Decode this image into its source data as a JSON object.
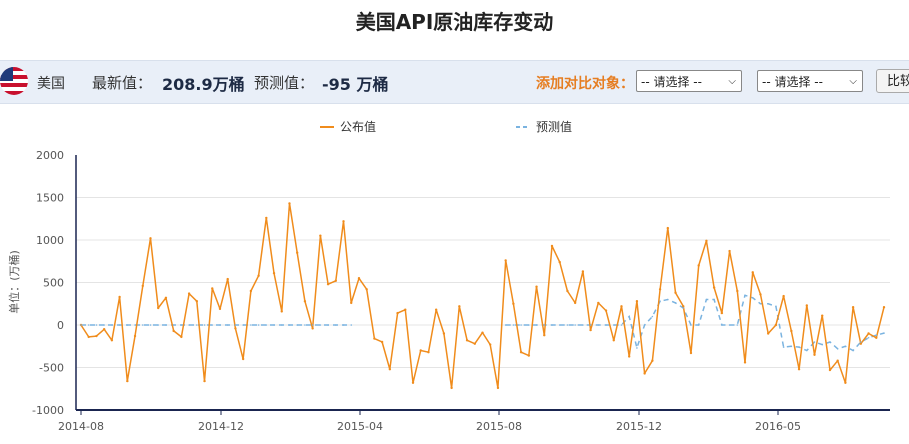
{
  "page": {
    "title": "美国API原油库存变动"
  },
  "info": {
    "country": "美国",
    "latest_label": "最新值：",
    "latest_value": "208.9万桶",
    "forecast_label": "预测值：",
    "forecast_value": "-95 万桶",
    "compare_label": "添加对比对象：",
    "select1": "-- 请选择 --",
    "select2": "-- 请选择 --",
    "compare_button": "比较"
  },
  "icons": {
    "flag": "us-flag-icon"
  },
  "colors": {
    "actual": "#f08c1c",
    "forecast": "#7ab3e0",
    "axis": "#1a2550"
  },
  "chart_data": {
    "type": "line",
    "ylabel": "单位：(万桶)",
    "ylim": [
      -1000,
      2000
    ],
    "yticks": [
      "2000",
      "1500",
      "1000",
      "500",
      "0",
      "-500",
      "-1000"
    ],
    "xticks": [
      "2014-08",
      "2014-12",
      "2015-04",
      "2015-08",
      "2015-12",
      "2016-05"
    ],
    "legend": [
      "公布值",
      "预测值"
    ],
    "legend_position": "top-center",
    "grid": true,
    "series": [
      {
        "name": "公布值",
        "values": [
          0,
          -140,
          -130,
          -50,
          -180,
          330,
          -660,
          -130,
          460,
          1020,
          200,
          320,
          -70,
          -140,
          370,
          280,
          -660,
          430,
          190,
          540,
          -40,
          -400,
          400,
          580,
          1260,
          610,
          160,
          1430,
          850,
          280,
          -40,
          1050,
          480,
          520,
          1220,
          260,
          550,
          420,
          -160,
          -200,
          -520,
          140,
          180,
          -680,
          -300,
          -320,
          180,
          -100,
          -740,
          220,
          -180,
          -220,
          -90,
          -230,
          -740,
          760,
          250,
          -320,
          -360,
          450,
          -120,
          930,
          740,
          400,
          260,
          630,
          -60,
          260,
          170,
          -180,
          220,
          -370,
          280,
          -570,
          -420,
          420,
          1140,
          380,
          220,
          -330,
          700,
          990,
          440,
          140,
          870,
          400,
          -440,
          620,
          360,
          -100,
          0,
          340,
          -70,
          -520,
          230,
          -350,
          110,
          -530,
          -420,
          -680,
          210,
          -220,
          -100,
          -150,
          209
        ]
      },
      {
        "name": "预测值",
        "values": [
          0,
          0,
          0,
          0,
          0,
          0,
          0,
          0,
          0,
          0,
          0,
          0,
          0,
          0,
          0,
          0,
          0,
          0,
          0,
          0,
          0,
          0,
          0,
          0,
          0,
          0,
          0,
          0,
          0,
          0,
          0,
          0,
          0,
          0,
          0,
          0,
          null,
          null,
          null,
          null,
          null,
          null,
          null,
          null,
          null,
          null,
          null,
          null,
          null,
          null,
          null,
          null,
          null,
          null,
          null,
          0,
          0,
          0,
          0,
          0,
          0,
          0,
          0,
          0,
          0,
          0,
          0,
          0,
          0,
          0,
          0,
          100,
          -270,
          0,
          100,
          280,
          300,
          260,
          200,
          0,
          0,
          300,
          300,
          0,
          0,
          0,
          350,
          320,
          250,
          250,
          220,
          -260,
          -250,
          -260,
          -300,
          -200,
          -230,
          -200,
          -280,
          -250,
          -300,
          -200,
          -150,
          -120,
          -95
        ]
      }
    ]
  }
}
